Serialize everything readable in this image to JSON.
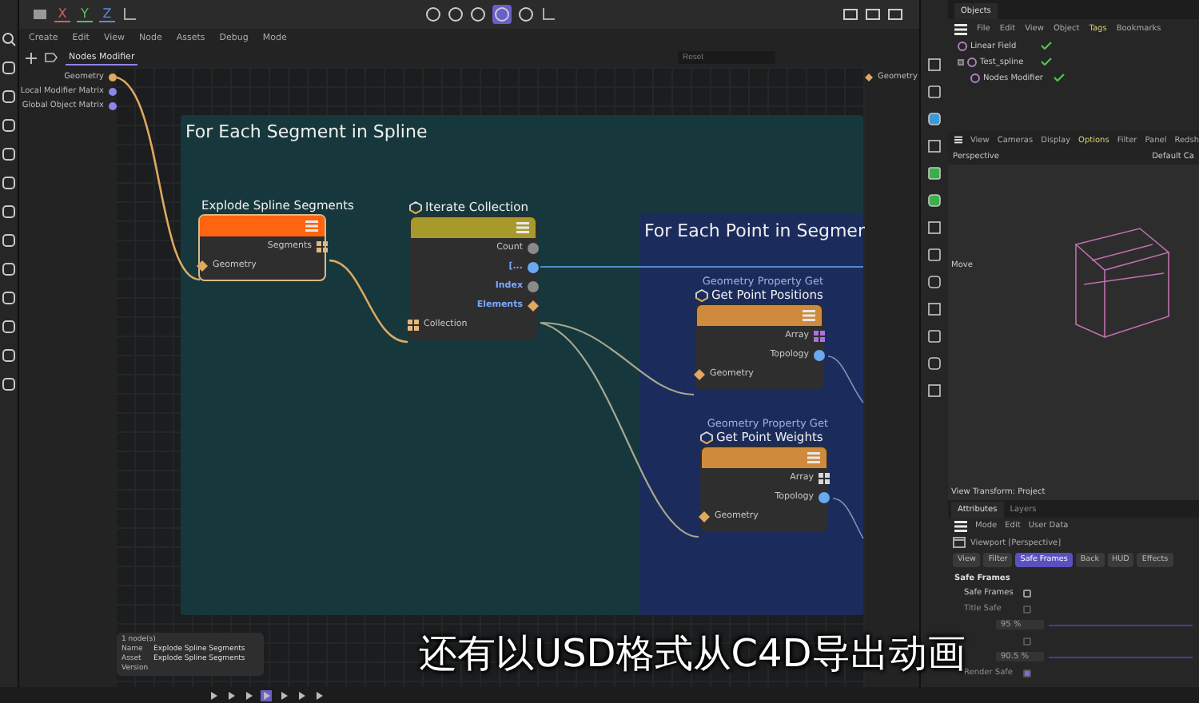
{
  "toolbar": {
    "axes": [
      {
        "label": "X",
        "color": "#e05a5a"
      },
      {
        "label": "Y",
        "color": "#5cc05c"
      },
      {
        "label": "Z",
        "color": "#5a8ae0"
      }
    ]
  },
  "editor": {
    "menu": [
      "Create",
      "Edit",
      "View",
      "Node",
      "Assets",
      "Debug",
      "Mode"
    ],
    "tabs": [
      {
        "label": "Nodes Modifier",
        "selected": true
      }
    ],
    "search": {
      "placeholder": "Reset"
    },
    "inputs": [
      {
        "label": "Geometry",
        "color": "#e0a860"
      },
      {
        "label": "Local Modifier Matrix",
        "color": "#8c84e8"
      },
      {
        "label": "Global Object Matrix",
        "color": "#8c84e8"
      }
    ],
    "outputs": [
      {
        "label": "Geometry",
        "color": "#e0a860"
      }
    ],
    "groups": [
      {
        "title": "For Each Segment in Spline",
        "color": "#16383c"
      },
      {
        "title": "For Each Point in Segmen",
        "color": "#1b2c5c"
      }
    ],
    "nodes": [
      {
        "title": "Explode Spline Segments",
        "color": "#ff6410",
        "selected": true,
        "outputs": [
          {
            "label": "Segments",
            "kind": "grid",
            "color": "#e0b880",
            "accent": false
          }
        ],
        "inputs": [
          {
            "label": "Geometry",
            "kind": "diamond",
            "color": "#e0a860",
            "accent": false
          }
        ]
      },
      {
        "title": "Iterate Collection",
        "color": "#a89a2a",
        "selected": false,
        "outputs": [
          {
            "label": "Count",
            "kind": "circle",
            "color": "#8a8a8a",
            "accent": false
          },
          {
            "label": "[...",
            "kind": "circle",
            "color": "#6aa8f0",
            "accent": true
          },
          {
            "label": "Index",
            "kind": "circle",
            "color": "#8a8a8a",
            "accent": true
          },
          {
            "label": "Elements",
            "kind": "diamond",
            "color": "#e0a860",
            "accent": true
          }
        ],
        "inputs": [
          {
            "label": "Collection",
            "kind": "grid",
            "color": "#e0b880",
            "accent": false
          }
        ]
      },
      {
        "subtitle": "Geometry Property Get",
        "title": "Get Point Positions",
        "color": "#d08a3c",
        "selected": false,
        "outputs": [
          {
            "label": "Array",
            "kind": "grid",
            "color": "#b070e0",
            "accent": false
          },
          {
            "label": "Topology",
            "kind": "circle",
            "color": "#6aa8f0",
            "accent": false
          }
        ],
        "inputs": [
          {
            "label": "Geometry",
            "kind": "diamond",
            "color": "#e0a860",
            "accent": false
          }
        ]
      },
      {
        "subtitle": "Geometry Property Get",
        "title": "Get Point Weights",
        "color": "#d08a3c",
        "selected": false,
        "outputs": [
          {
            "label": "Array",
            "kind": "grid",
            "color": "#d8d8d8",
            "accent": false
          },
          {
            "label": "Topology",
            "kind": "circle",
            "color": "#6aa8f0",
            "accent": false
          }
        ],
        "inputs": [
          {
            "label": "Geometry",
            "kind": "diamond",
            "color": "#e0a860",
            "accent": false
          }
        ]
      }
    ],
    "info": {
      "heading": "1 node(s)",
      "rows": [
        {
          "label": "Name",
          "value": "Explode Spline Segments"
        },
        {
          "label": "Asset",
          "value": "Explode Spline Segments"
        },
        {
          "label": "Version"
        }
      ]
    }
  },
  "objects": {
    "tabs": [
      {
        "label": "Objects",
        "selected": true
      }
    ],
    "menu": [
      {
        "label": "File",
        "selected": false
      },
      {
        "label": "Edit",
        "selected": false
      },
      {
        "label": "View",
        "selected": false
      },
      {
        "label": "Object",
        "selected": false
      },
      {
        "label": "Tags",
        "selected": true
      },
      {
        "label": "Bookmarks",
        "selected": false
      }
    ],
    "tree": [
      {
        "label": "Linear Field",
        "enabled": true
      },
      {
        "label": "Test_spline",
        "enabled": true,
        "expanded": true,
        "children": [
          {
            "label": "Nodes Modifier",
            "enabled": true
          }
        ]
      }
    ]
  },
  "viewport": {
    "menu": [
      {
        "label": "View",
        "selected": false
      },
      {
        "label": "Cameras",
        "selected": false
      },
      {
        "label": "Display",
        "selected": false
      },
      {
        "label": "Options",
        "selected": true
      },
      {
        "label": "Filter",
        "selected": false
      },
      {
        "label": "Panel",
        "selected": false
      },
      {
        "label": "Redsh",
        "selected": false
      }
    ],
    "camera": "Perspective",
    "camera_right": "Default Ca",
    "tool": "Move",
    "footer": "View Transform: Project"
  },
  "attributes": {
    "tabs": [
      {
        "label": "Attributes",
        "selected": true
      },
      {
        "label": "Layers",
        "selected": false
      }
    ],
    "menu": [
      "Mode",
      "Edit",
      "User Data"
    ],
    "header": "Viewport [Perspective]",
    "buttons": [
      {
        "label": "View",
        "selected": false
      },
      {
        "label": "Filter",
        "selected": false
      },
      {
        "label": "Safe Frames",
        "selected": true
      },
      {
        "label": "Back",
        "selected": false
      },
      {
        "label": "HUD",
        "selected": false
      },
      {
        "label": "Effects",
        "selected": false
      }
    ],
    "section": "Safe Frames",
    "rows": [
      {
        "kind": "check",
        "label": "Safe Frames",
        "checked": false,
        "disabled": false
      },
      {
        "kind": "check",
        "label": "Title Safe",
        "checked": false,
        "disabled": true
      },
      {
        "kind": "value",
        "value": "95 %",
        "disabled": true
      },
      {
        "kind": "check",
        "checked": false,
        "disabled": true
      },
      {
        "kind": "value",
        "value": "90.5 %",
        "disabled": true
      },
      {
        "kind": "check",
        "label": "Render Safe",
        "checked": true,
        "disabled": true
      }
    ]
  },
  "subtitle": "还有以USD格式从C4D导出动画"
}
